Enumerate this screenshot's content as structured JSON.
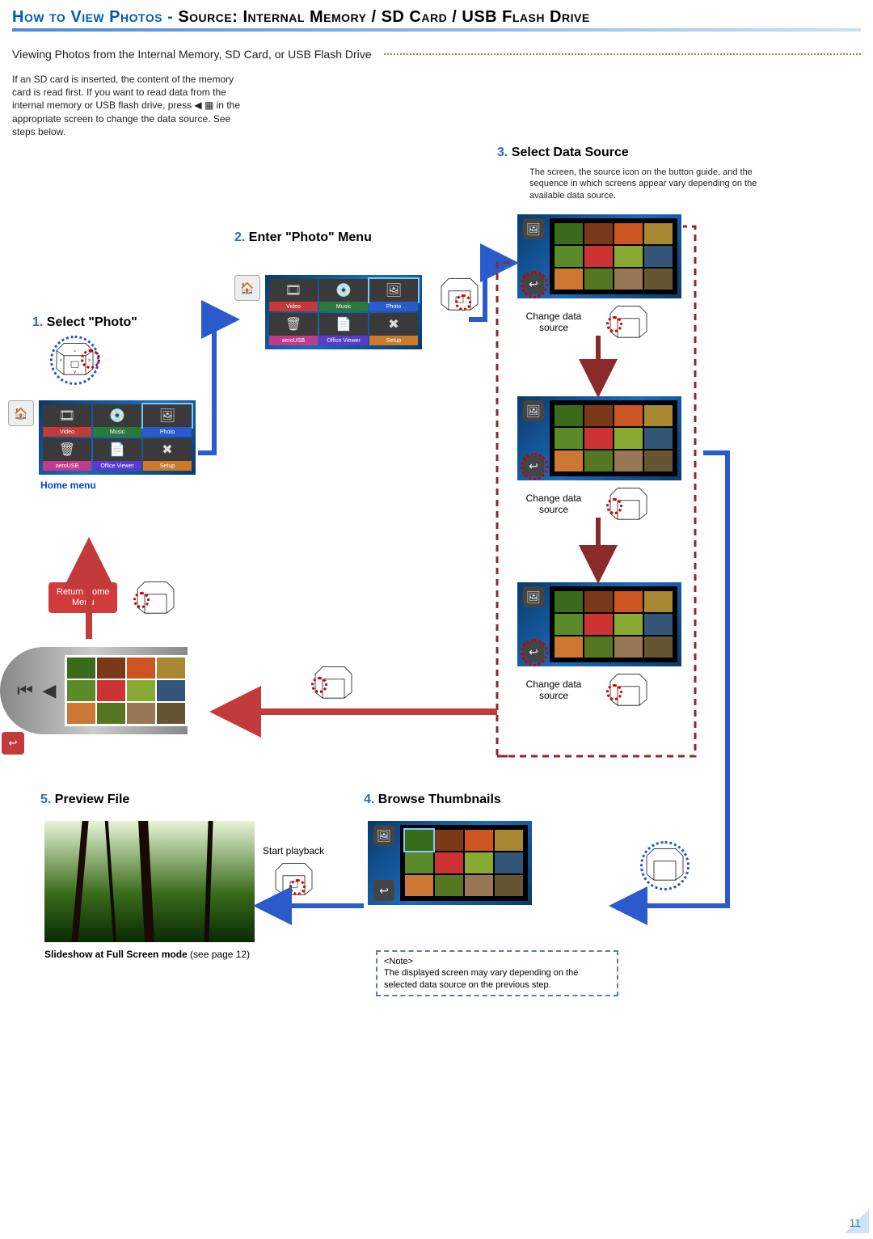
{
  "title": {
    "prefix": "How to View Photos - ",
    "suffix": "Source: Internal Memory / SD Card / USB Flash Drive"
  },
  "subtitle": "Viewing Photos from the Internal Memory, SD Card, or USB Flash Drive",
  "intro": "If an SD card is inserted, the content of the memory card is read first. If you want to read data from the internal memory or USB flash drive, press ◀ ▦ in the appropriate screen to change the data source. See steps below.",
  "steps": {
    "s1": {
      "num": "1.",
      "title": "Select \"Photo\""
    },
    "s2": {
      "num": "2.",
      "title": "Enter \"Photo\" Menu"
    },
    "s3": {
      "num": "3.",
      "title": "Select Data Source"
    },
    "s4": {
      "num": "4.",
      "title": "Browse Thumbnails"
    },
    "s5": {
      "num": "5.",
      "title": "Preview File"
    }
  },
  "step3_desc": "The screen, the source icon on the button guide, and the sequence in which screens appear vary depending on the available data source.",
  "labels": {
    "home_menu": "Home menu",
    "return_home": "Return Home Menu",
    "change_source": "Change data source",
    "start_playback": "Start playback",
    "slideshow": "Slideshow at Full Screen mode ",
    "slideshow_ref": "(see page 12)"
  },
  "menu_tiles": [
    {
      "icon": "🎞",
      "label": "Video",
      "color": "#c23a3a"
    },
    {
      "icon": "💿",
      "label": "Music",
      "color": "#2a7a3a"
    },
    {
      "icon": "🖼",
      "label": "Photo",
      "color": "#2a5acc"
    },
    {
      "icon": "🗑",
      "label": "aeroUSB",
      "color": "#c23a8a"
    },
    {
      "icon": "📄",
      "label": "Office Viewer",
      "color": "#5a3acc"
    },
    {
      "icon": "✖",
      "label": "Setup",
      "color": "#cc7a2a"
    }
  ],
  "note": {
    "header": "<Note>",
    "body": "The displayed screen may vary depending on the selected data source on the previous step."
  },
  "page_number": "11",
  "thumb_colors": [
    "#3a6b1a",
    "#7a3a1a",
    "#cc5522",
    "#aa8833",
    "#5a8a2a",
    "#cc3333",
    "#88aa33",
    "#335577",
    "#cc7733",
    "#557722",
    "#997755",
    "#665533"
  ]
}
